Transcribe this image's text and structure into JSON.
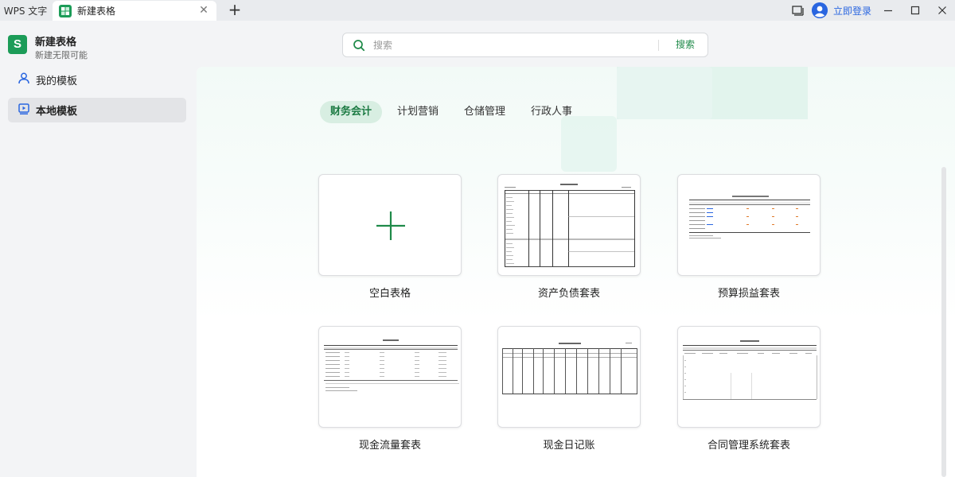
{
  "titlebar": {
    "app_tab_label": "WPS 文字",
    "doc_tab_label": "新建表格",
    "login_label": "立即登录"
  },
  "sidebar": {
    "app_title": "新建表格",
    "app_subtitle": "新建无限可能",
    "logo_letter": "S",
    "items": [
      {
        "label": "我的模板"
      },
      {
        "label": "本地模板"
      }
    ]
  },
  "search": {
    "placeholder": "搜索",
    "button_label": "搜索"
  },
  "categories": [
    {
      "label": "财务会计"
    },
    {
      "label": "计划营销"
    },
    {
      "label": "仓储管理"
    },
    {
      "label": "行政人事"
    }
  ],
  "templates": [
    {
      "name": "空白表格"
    },
    {
      "name": "资产负债套表"
    },
    {
      "name": "预算损益套表"
    },
    {
      "name": "现金流量套表"
    },
    {
      "name": "现金日记账"
    },
    {
      "name": "合同管理系统套表"
    }
  ],
  "colors": {
    "accent_green": "#1f8a49",
    "login_blue": "#2a66e0"
  }
}
